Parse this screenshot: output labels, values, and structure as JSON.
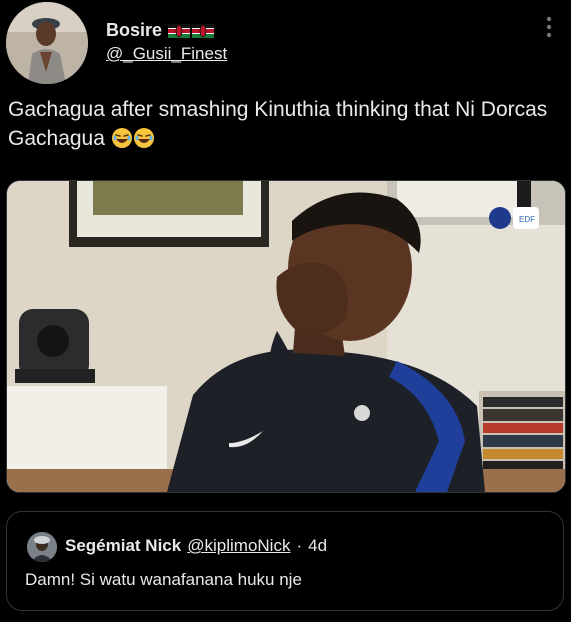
{
  "author": {
    "display_name": "Bosire",
    "handle": "@_Gusii_Finest",
    "flag_emoji": "kenya-flag-icon",
    "avatar_icon": "profile-photo"
  },
  "tweet": {
    "text": "Gachagua after smashing Kinuthia thinking that Ni Dorcas Gachagua",
    "emojis": [
      "😂",
      "😂"
    ]
  },
  "media": {
    "description_icon": "video-thumbnail",
    "brand_badges": [
      "fff-logo-icon",
      "edf-logo-icon"
    ],
    "badge_text": "EDF"
  },
  "quoted_tweet": {
    "display_name": "Segémiat Nick",
    "handle": "@kiplimoNick",
    "separator": "·",
    "time": "4d",
    "text": "Damn! Si watu wanafanana huku nje"
  },
  "colors": {
    "background": "#000000",
    "text": "#e7e9ea",
    "border": "#2f3336"
  }
}
